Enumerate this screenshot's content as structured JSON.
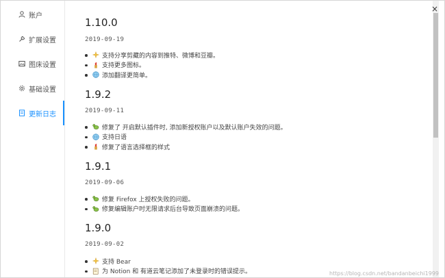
{
  "sidebar": {
    "items": [
      {
        "label": "账户",
        "icon": "user-icon"
      },
      {
        "label": "扩展设置",
        "icon": "wrench-icon"
      },
      {
        "label": "图床设置",
        "icon": "image-icon"
      },
      {
        "label": "基础设置",
        "icon": "gear-icon"
      },
      {
        "label": "更新日志",
        "icon": "file-text-icon",
        "active": true
      }
    ]
  },
  "changelog": [
    {
      "version": "1.10.0",
      "date": "2019-09-19",
      "items": [
        {
          "emoji": "sparkles",
          "text": "支持分享剪藏的内容到推特、微博和豆瓣。"
        },
        {
          "emoji": "lipstick",
          "text": "支持更多图标。"
        },
        {
          "emoji": "globe",
          "text": "添加翻译更简单。"
        }
      ]
    },
    {
      "version": "1.9.2",
      "date": "2019-09-11",
      "items": [
        {
          "emoji": "bug",
          "text": "修复了 开启默认插件时, 添加新授权账户以及默认账户失效的问题。"
        },
        {
          "emoji": "globe",
          "text": "支持日语"
        },
        {
          "emoji": "lipstick",
          "text": "修复了语言选择框的样式"
        }
      ]
    },
    {
      "version": "1.9.1",
      "date": "2019-09-06",
      "items": [
        {
          "emoji": "bug",
          "text": "修复 Firefox 上授权失败的问题。"
        },
        {
          "emoji": "bug",
          "text": "修复编辑账户时无限请求后台导致页面崩溃的问题。"
        }
      ]
    },
    {
      "version": "1.9.0",
      "date": "2019-09-02",
      "items": [
        {
          "emoji": "sparkles",
          "text": "支持 Bear"
        },
        {
          "emoji": "memo",
          "text": "为 Notion 和 有道云笔记添加了未登录时的错误提示。"
        }
      ]
    }
  ],
  "close_symbol": "×",
  "watermark": "https://blog.csdn.net/bandanbeichi1999"
}
